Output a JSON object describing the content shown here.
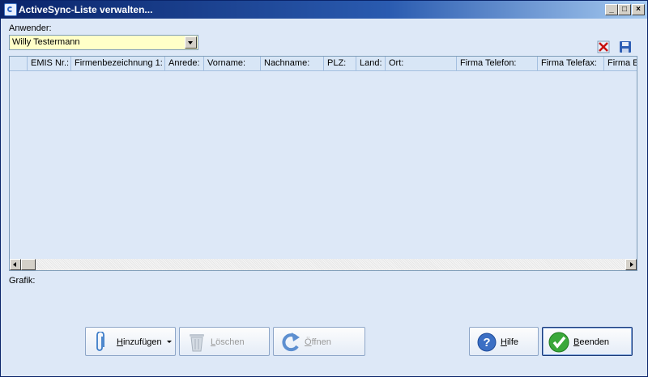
{
  "window": {
    "title": "ActiveSync-Liste verwalten...",
    "controls": {
      "minimize": "_",
      "maximize": "□",
      "close": "×"
    }
  },
  "user": {
    "label": "Anwender:",
    "selected": "Willy Testermann"
  },
  "grid": {
    "columns": [
      "EMIS Nr.:",
      "Firmenbezeichnung 1:",
      "Anrede:",
      "Vorname:",
      "Nachname:",
      "PLZ:",
      "Land:",
      "Ort:",
      "Firma Telefon:",
      "Firma Telefax:",
      "Firma E"
    ],
    "rows": []
  },
  "grafik_label": "Grafik:",
  "buttons": {
    "add": {
      "underline": "H",
      "rest": "inzufügen"
    },
    "delete": {
      "underline": "L",
      "rest": "öschen"
    },
    "open": {
      "underline": "Ö",
      "rest": "ffnen"
    },
    "help": {
      "underline": "H",
      "rest": "ilfe"
    },
    "exit": {
      "underline": "B",
      "rest": "eenden"
    }
  },
  "colors": {
    "window_bg": "#dde8f7",
    "combo_bg": "#ffffc8",
    "title_bar": "#0a246a"
  },
  "icons": [
    "app-icon",
    "clear-red-x-icon",
    "save-floppy-icon",
    "paperclip-icon",
    "trash-bin-icon",
    "refresh-arrow-icon",
    "help-question-icon",
    "checkmark-icon"
  ]
}
